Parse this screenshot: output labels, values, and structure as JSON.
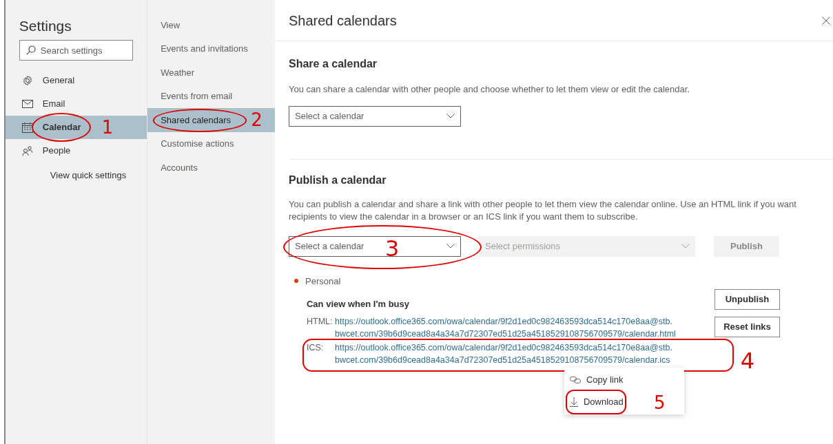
{
  "sidebar": {
    "title": "Settings",
    "search": {
      "placeholder": "Search settings"
    },
    "items": [
      {
        "label": "General",
        "selected": false
      },
      {
        "label": "Email",
        "selected": false
      },
      {
        "label": "Calendar",
        "selected": true,
        "annotation": "1"
      },
      {
        "label": "People",
        "selected": false
      }
    ],
    "quick_settings_link": "View quick settings"
  },
  "subnav": {
    "items": [
      {
        "label": "View",
        "selected": false
      },
      {
        "label": "Events and invitations",
        "selected": false
      },
      {
        "label": "Weather",
        "selected": false
      },
      {
        "label": "Events from email",
        "selected": false
      },
      {
        "label": "Shared calendars",
        "selected": true,
        "annotation": "2"
      },
      {
        "label": "Customise actions",
        "selected": false
      },
      {
        "label": "Accounts",
        "selected": false
      }
    ]
  },
  "panel": {
    "title": "Shared calendars",
    "share": {
      "heading": "Share a calendar",
      "description": "You can share a calendar with other people and choose whether to let them view or edit the calendar.",
      "select": {
        "placeholder": "Select a calendar"
      }
    },
    "publish": {
      "heading": "Publish a calendar",
      "description": "You can publish a calendar and share a link with other people to let them view the calendar online. Use an HTML link if you want recipients to view the calendar in a browser or an ICS link if you want them to subscribe.",
      "calendar_select": {
        "placeholder": "Select a calendar",
        "annotation": "3"
      },
      "permissions_select": {
        "placeholder": "Select permissions",
        "disabled": true
      },
      "publish_button": {
        "label": "Publish",
        "disabled": true
      },
      "calendar": {
        "name": "Personal",
        "color": "#d83b01",
        "permission": "Can view when I'm busy",
        "links": [
          {
            "label": "HTML:",
            "lines": [
              "https://outlook.office365.com/owa/calendar/9f2d1ed0c982463593dca514c170e8aa@stb.",
              "bwcet.com/39b6d9cead8a4a34a7d72307ed51d25a4518529108756709579/calendar.html"
            ]
          },
          {
            "label": "ICS:",
            "lines": [
              "https://outlook.office365.com/owa/calendar/9f2d1ed0c982463593dca514c170e8aa@stb.",
              "bwcet.com/39b6d9cead8a4a34a7d72307ed51d25a4518529108756709579/calendar.ics"
            ],
            "annotation": "4"
          }
        ],
        "buttons": [
          "Unpublish",
          "Reset links"
        ]
      },
      "context_menu": {
        "items": [
          {
            "label": "Copy link"
          },
          {
            "label": "Download",
            "annotation": "5"
          }
        ]
      }
    }
  }
}
